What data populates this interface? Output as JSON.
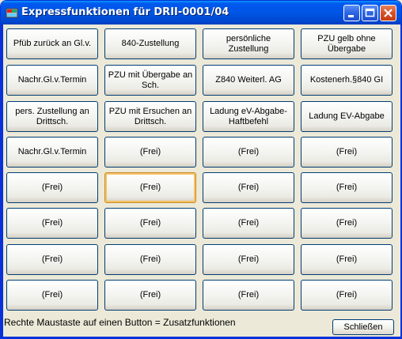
{
  "window": {
    "title": "Expressfunktionen für DRII-0001/04",
    "minimize_icon": "minimize-icon",
    "maximize_icon": "maximize-icon",
    "close_icon": "close-icon",
    "app_icon": "app-icon"
  },
  "buttons": [
    [
      "Pfüb zurück an Gl.v.",
      "840-Zustellung",
      "persönliche Zustellung",
      "PZU gelb ohne Übergabe"
    ],
    [
      "Nachr.Gl.v.Termin",
      "PZU mit Übergabe an Sch.",
      "Z840 Weiterl. AG",
      "Kostenerh.§840 GI"
    ],
    [
      "pers. Zustellung an Drittsch.",
      "PZU mit Ersuchen an Drittsch.",
      "Ladung eV-Abgabe-Haftbefehl",
      "Ladung EV-Abgabe"
    ],
    [
      "Nachr.Gl.v.Termin",
      "(Frei)",
      "(Frei)",
      "(Frei)"
    ],
    [
      "(Frei)",
      "(Frei)",
      "(Frei)",
      "(Frei)"
    ],
    [
      "(Frei)",
      "(Frei)",
      "(Frei)",
      "(Frei)"
    ],
    [
      "(Frei)",
      "(Frei)",
      "(Frei)",
      "(Frei)"
    ],
    [
      "(Frei)",
      "(Frei)",
      "(Frei)",
      "(Frei)"
    ]
  ],
  "focused_button": [
    4,
    1
  ],
  "status_text": "Rechte Maustaste auf einen Button = Zusatzfunktionen",
  "close_button_label": "Schließen",
  "colors": {
    "titlebar": "#0055e5",
    "window_bg": "#ece9d8",
    "focus_ring": "#f5c263",
    "close_red": "#d6512b"
  }
}
